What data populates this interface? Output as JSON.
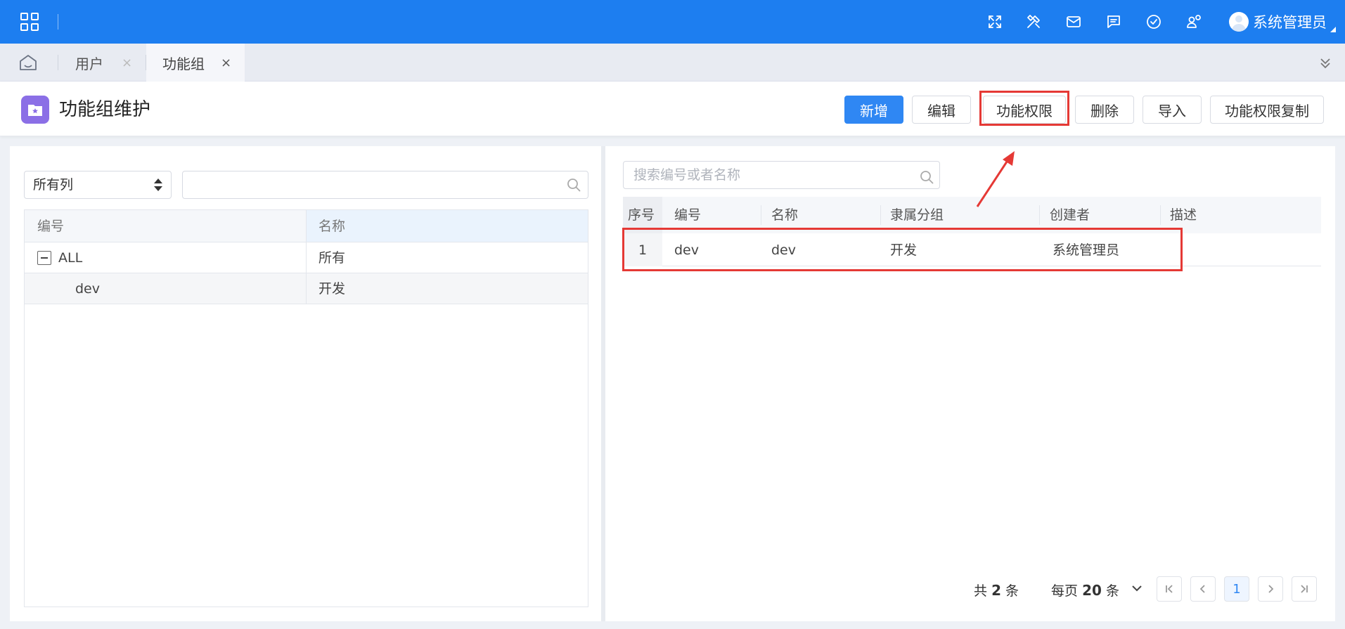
{
  "topbar": {
    "username": "系统管理员",
    "icons": [
      "apps-grid-icon",
      "fullscreen-icon",
      "tools-icon",
      "mail-icon",
      "message-icon",
      "check-circle-icon",
      "user-settings-icon"
    ]
  },
  "tabs": [
    {
      "label": "用户",
      "close": "×",
      "active": false
    },
    {
      "label": "功能组",
      "close": "×",
      "active": true
    }
  ],
  "page": {
    "title": "功能组维护",
    "buttons": {
      "add": "新增",
      "edit": "编辑",
      "permissions": "功能权限",
      "delete": "删除",
      "import": "导入",
      "copy_permissions": "功能权限复制"
    }
  },
  "left": {
    "select_value": "所有列",
    "search_value": "",
    "columns": [
      "编号",
      "名称"
    ],
    "rows": [
      {
        "code": "ALL",
        "name": "所有"
      },
      {
        "code": "dev",
        "name": "开发"
      }
    ]
  },
  "right": {
    "search_placeholder": "搜索编号或者名称",
    "columns": [
      "序号",
      "编号",
      "名称",
      "隶属分组",
      "创建者",
      "描述"
    ],
    "rows": [
      {
        "seq": "1",
        "code": "dev",
        "name": "dev",
        "group": "开发",
        "creator": "系统管理员",
        "desc": ""
      }
    ],
    "pager": {
      "total_prefix": "共",
      "total": "2",
      "total_suffix": "条",
      "size_prefix": "每页",
      "size": "20",
      "size_suffix": "条",
      "current_page": "1"
    }
  },
  "colors": {
    "topbar": "#1d7ef0",
    "primary_button": "#2f87f3",
    "highlight": "#e53935",
    "page_icon": "#8b6fe6"
  }
}
